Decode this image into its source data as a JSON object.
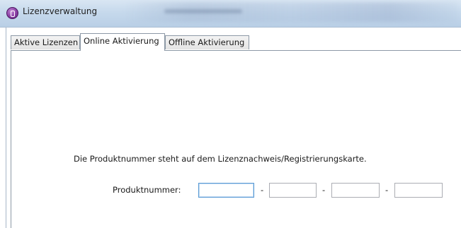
{
  "window": {
    "title": "Lizenzverwaltung"
  },
  "tabs": [
    {
      "label": "Aktive Lizenzen",
      "active": false
    },
    {
      "label": "Online Aktivierung",
      "active": true
    },
    {
      "label": "Offline Aktivierung",
      "active": false
    }
  ],
  "online_activation": {
    "info_text": "Die Produktnummer steht auf dem Lizenznachweis/Registrierungskarte.",
    "product_number_label": "Produktnummer:",
    "separator": "-",
    "fields": [
      "",
      "",
      "",
      ""
    ]
  },
  "colors": {
    "titlebar": "#c6d9ec",
    "app_icon": "#8a3fa5",
    "focus_border": "#5a9bd5"
  },
  "icons": {
    "app_icon": "app-icon"
  }
}
